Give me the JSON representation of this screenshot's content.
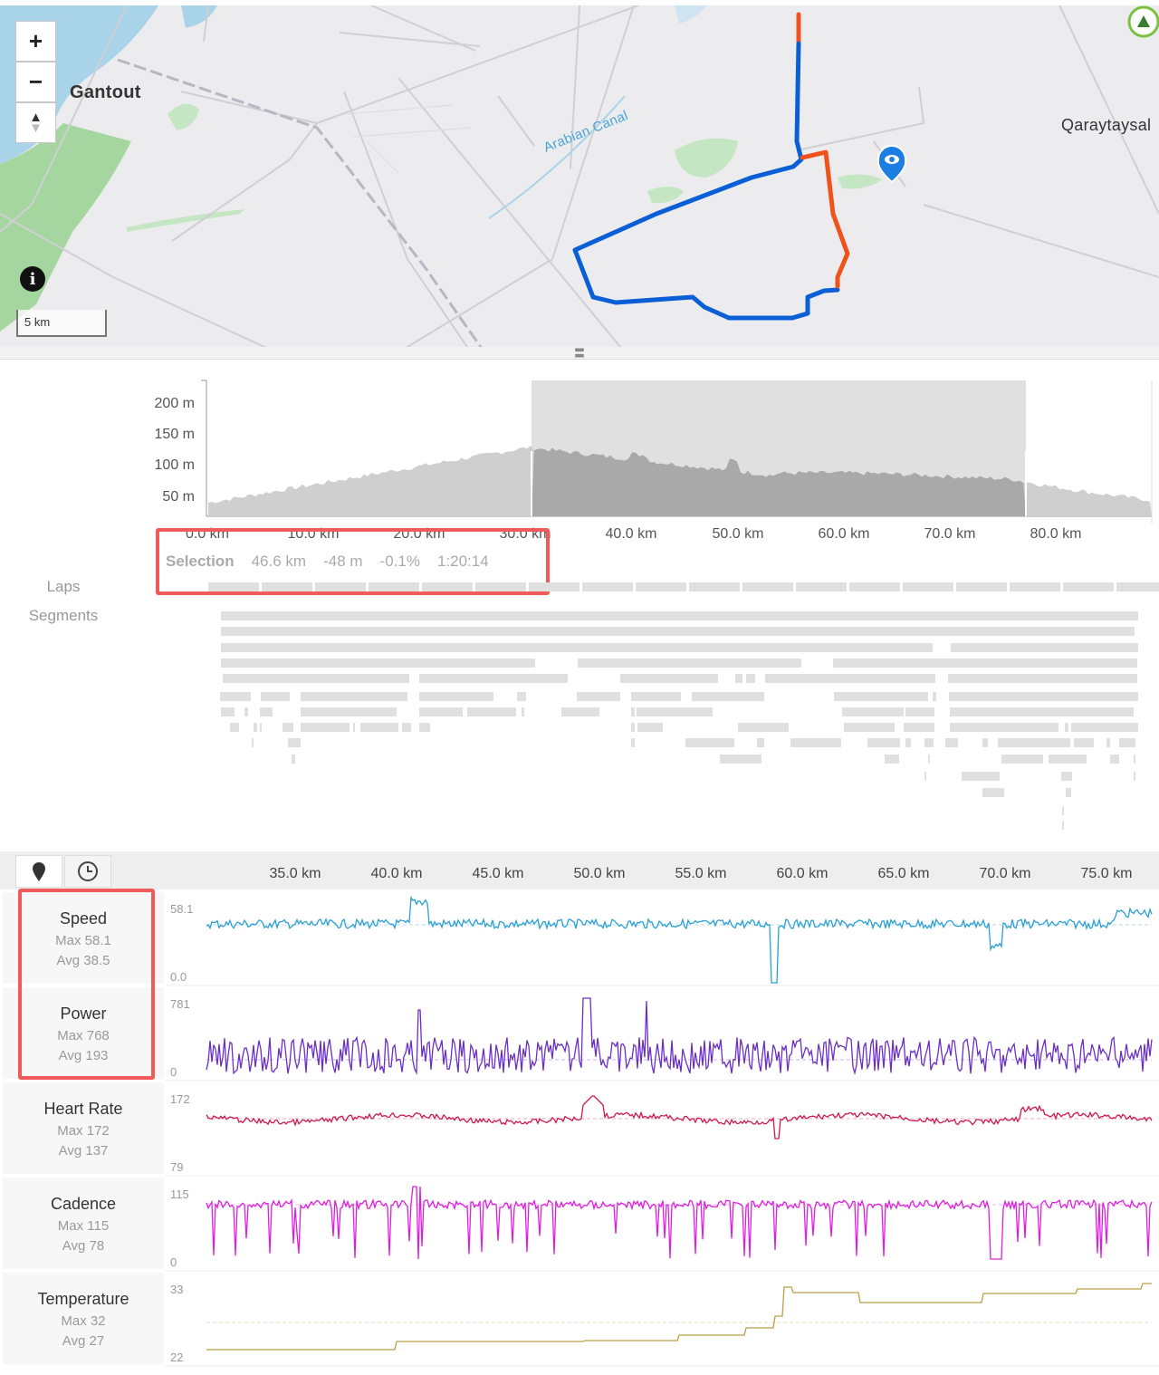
{
  "map": {
    "zoom_in_label": "+",
    "zoom_out_label": "−",
    "compass_label": "▲",
    "place_gantout": "Gantout",
    "place_qaraytaysal": "Qaraytaysal",
    "canal_label": "Arabian Canal",
    "scale_label": "5 km",
    "info_label": "i",
    "route_colors": {
      "main": "#0a5fd6",
      "highlight": "#f0521c"
    }
  },
  "elevation": {
    "y_ticks": [
      "200 m",
      "150 m",
      "100 m",
      "50 m"
    ],
    "x_ticks": [
      "0.0 km",
      "10.0 km",
      "20.0 km",
      "30.0 km",
      "40.0 km",
      "50.0 km",
      "60.0 km",
      "70.0 km",
      "80.0 km"
    ],
    "selection": {
      "label": "Selection",
      "distance": "46.6 km",
      "elevation": "-48 m",
      "grade": "-0.1%",
      "time": "1:20:14"
    },
    "laps_label": "Laps",
    "segments_label": "Segments"
  },
  "streams": {
    "km_ticks": [
      "35.0 km",
      "40.0 km",
      "45.0 km",
      "50.0 km",
      "55.0 km",
      "60.0 km",
      "65.0 km",
      "70.0 km",
      "75.0 km"
    ],
    "items": [
      {
        "name": "Speed",
        "max": "Max 58.1",
        "avg": "Avg 38.5",
        "top": "58.1",
        "bottom": "0.0",
        "color": "#2a9fd6"
      },
      {
        "name": "Power",
        "max": "Max 768",
        "avg": "Avg 193",
        "top": "781",
        "bottom": "0",
        "color": "#6a2fc9"
      },
      {
        "name": "Heart Rate",
        "max": "Max 172",
        "avg": "Avg 137",
        "top": "172",
        "bottom": "79",
        "color": "#d1174e"
      },
      {
        "name": "Cadence",
        "max": "Max 115",
        "avg": "Avg 78",
        "top": "115",
        "bottom": "0",
        "color": "#e01ee0"
      },
      {
        "name": "Temperature",
        "max": "Max 32",
        "avg": "Avg 27",
        "top": "33",
        "bottom": "22",
        "color": "#b8a045"
      }
    ]
  }
}
